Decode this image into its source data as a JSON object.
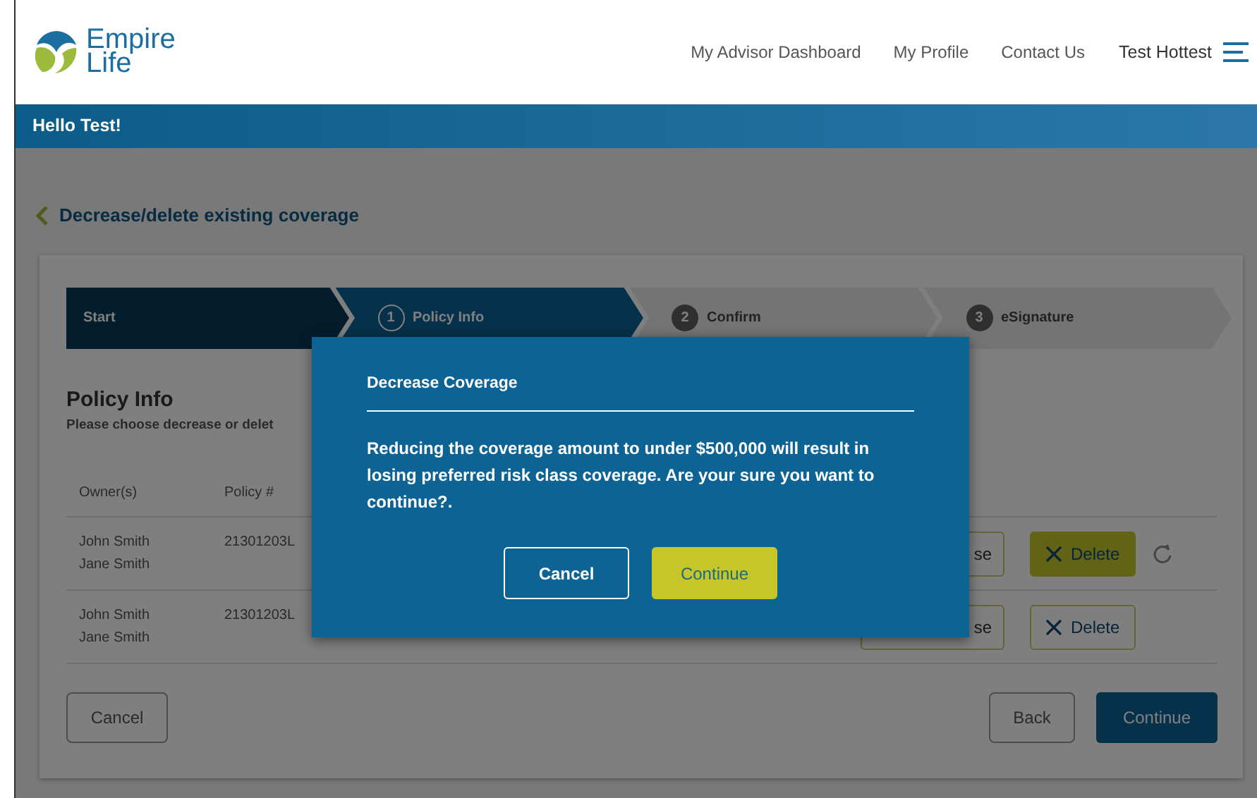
{
  "header": {
    "logo_lines": [
      "Empire",
      "Life"
    ],
    "nav": [
      "My Advisor Dashboard",
      "My Profile",
      "Contact Us"
    ],
    "user": "Test Hottest"
  },
  "greeting": "Hello Test!",
  "page_title": "Decrease/delete existing coverage",
  "steps": [
    {
      "label": "Start",
      "completed": true,
      "selected": false
    },
    {
      "label": "Policy Info",
      "number": "1",
      "completed": false,
      "selected": true
    },
    {
      "label": "Confirm",
      "number": "2",
      "completed": false,
      "selected": false
    },
    {
      "label": "eSignature",
      "number": "3",
      "completed": false,
      "selected": false
    }
  ],
  "section": {
    "title": "Policy Info",
    "subtitle": "Please choose decrease or delet"
  },
  "table": {
    "columns": [
      "Owner(s)",
      "Policy #"
    ],
    "rows": [
      {
        "owners": [
          "John Smith",
          "Jane Smith"
        ],
        "policy": "21301203L",
        "decrease_label": "se",
        "delete_label": "Delete",
        "delete_selected": true,
        "undo": true
      },
      {
        "owners": [
          "John Smith",
          "Jane Smith"
        ],
        "policy": "21301203L",
        "decrease_label": "se",
        "delete_label": "Delete",
        "delete_selected": false,
        "undo": false
      }
    ]
  },
  "footer_buttons": {
    "cancel": "Cancel",
    "back": "Back",
    "continue": "Continue"
  },
  "modal": {
    "title": "Decrease Coverage",
    "message": "Reducing the coverage amount to under $500,000 will result in losing preferred risk class coverage. Are your sure you want to continue?.",
    "cancel": "Cancel",
    "confirm": "Continue"
  }
}
